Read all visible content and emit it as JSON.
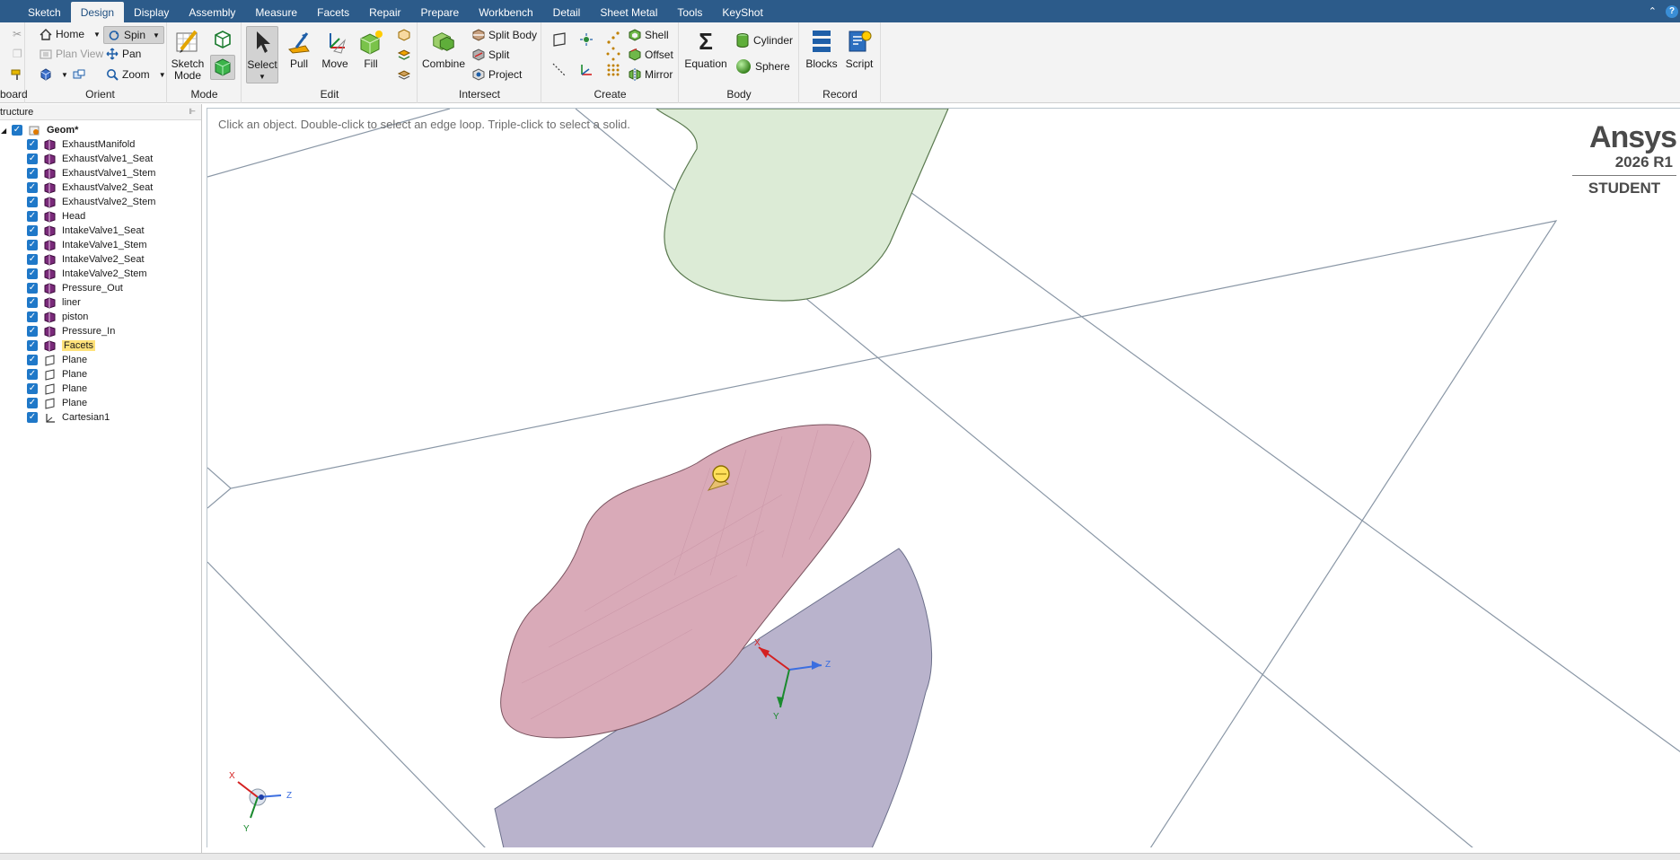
{
  "menu": {
    "tabs": [
      "Sketch",
      "Design",
      "Display",
      "Assembly",
      "Measure",
      "Facets",
      "Repair",
      "Prepare",
      "Workbench",
      "Detail",
      "Sheet Metal",
      "Tools",
      "KeyShot"
    ],
    "active_tab": "Design",
    "minimize_glyph": "⌃",
    "help_glyph": "?"
  },
  "ribbon": {
    "clipboard": {
      "label": "board"
    },
    "orient": {
      "label": "Orient",
      "home": "Home",
      "spin": "Spin",
      "plan_view": "Plan View",
      "pan": "Pan",
      "zoom": "Zoom"
    },
    "mode": {
      "label": "Mode",
      "sketch_mode_1": "Sketch",
      "sketch_mode_2": "Mode"
    },
    "edit": {
      "label": "Edit",
      "select": "Select",
      "pull": "Pull",
      "move": "Move",
      "fill": "Fill"
    },
    "intersect": {
      "label": "Intersect",
      "combine": "Combine",
      "split_body": "Split Body",
      "split": "Split",
      "project": "Project"
    },
    "create": {
      "label": "Create",
      "shell": "Shell",
      "offset": "Offset",
      "mirror": "Mirror"
    },
    "body": {
      "label": "Body",
      "equation": "Equation",
      "cylinder": "Cylinder",
      "sphere": "Sphere"
    },
    "record": {
      "label": "Record",
      "blocks": "Blocks",
      "script": "Script"
    }
  },
  "structure": {
    "title": "tructure",
    "root": "Geom*",
    "items": [
      {
        "label": "ExhaustManifold",
        "type": "body"
      },
      {
        "label": "ExhaustValve1_Seat",
        "type": "body"
      },
      {
        "label": "ExhaustValve1_Stem",
        "type": "body"
      },
      {
        "label": "ExhaustValve2_Seat",
        "type": "body"
      },
      {
        "label": "ExhaustValve2_Stem",
        "type": "body"
      },
      {
        "label": "Head",
        "type": "body"
      },
      {
        "label": "IntakeValve1_Seat",
        "type": "body"
      },
      {
        "label": "IntakeValve1_Stem",
        "type": "body"
      },
      {
        "label": "IntakeValve2_Seat",
        "type": "body"
      },
      {
        "label": "IntakeValve2_Stem",
        "type": "body"
      },
      {
        "label": "Pressure_Out",
        "type": "body"
      },
      {
        "label": "liner",
        "type": "body"
      },
      {
        "label": "piston",
        "type": "body"
      },
      {
        "label": "Pressure_In",
        "type": "body"
      },
      {
        "label": "Facets",
        "type": "body",
        "highlighted": true
      },
      {
        "label": "Plane",
        "type": "plane"
      },
      {
        "label": "Plane",
        "type": "plane"
      },
      {
        "label": "Plane",
        "type": "plane"
      },
      {
        "label": "Plane",
        "type": "plane"
      },
      {
        "label": "Cartesian1",
        "type": "axis"
      }
    ]
  },
  "viewport": {
    "hint": "Click an object. Double-click to select an edge loop. Triple-click to select a solid.",
    "logo": {
      "name": "Ansys",
      "version": "2026 R1",
      "edition": "STUDENT"
    },
    "triad": {
      "x": "X",
      "y": "Y",
      "z": "Z"
    }
  },
  "colors": {
    "menubar": "#2c5b8a",
    "checkbox": "#1f78c8",
    "body_pink": "#d9aab8",
    "body_green": "#dcebd6",
    "highlight": "#ffe27a"
  }
}
